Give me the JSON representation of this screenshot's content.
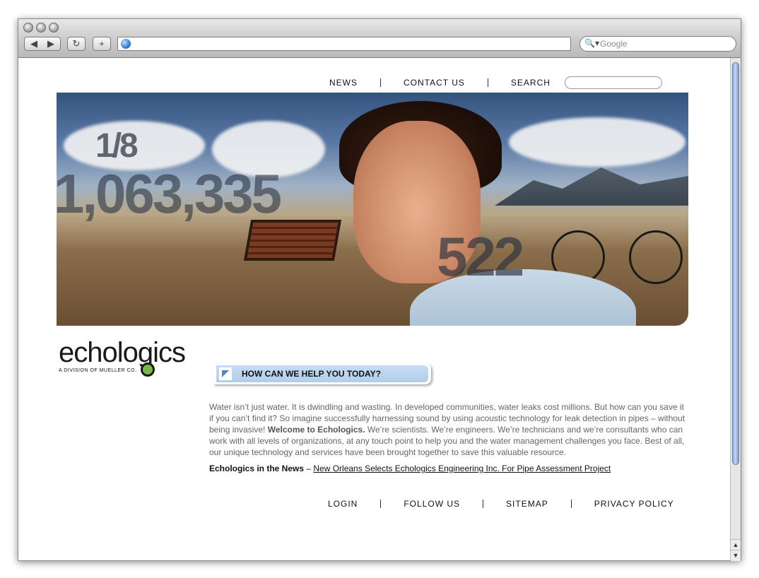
{
  "browser": {
    "url": "",
    "search_engine": "Google",
    "back_glyph": "◀",
    "forward_glyph": "▶",
    "reload_glyph": "↻",
    "add_glyph": "+",
    "search_glass_glyph": "🔍▾",
    "scroll_up_glyph": "▲",
    "scroll_down_glyph": "▼"
  },
  "top_nav": {
    "news": "NEWS",
    "contact": "CONTACT US",
    "search": "SEARCH",
    "search_value": ""
  },
  "hero": {
    "stat_fraction": "1/8",
    "stat_big": "1,063,335",
    "stat_522": "522"
  },
  "logo": {
    "name": "echologics",
    "tagline": "A DIVISION OF MUELLER CO."
  },
  "help_banner": "HOW CAN WE HELP YOU TODAY?",
  "intro": {
    "part1": "Water isn’t just water. It is dwindling and wasting. In developed communities, water leaks cost millions. But how can you save it if you can’t find it? So imagine successfully harnessing sound by using acoustic technology for leak detection in pipes – without being invasive! ",
    "bold": "Welcome to Echologics.",
    "part2": " We’re scientists. We’re engineers. We’re technicians and we’re consultants who can work with all levels of organizations, at any touch point to help you and the water management challenges you face. Best of all, our unique technology and services have been brought together to save this valuable resource."
  },
  "news": {
    "label": "Echologics in the News",
    "dash": " – ",
    "link": "New Orleans Selects Echologics Engineering Inc. For Pipe Assessment Project"
  },
  "footer_nav": {
    "login": "LOGIN",
    "follow": "FOLLOW US",
    "sitemap": "SITEMAP",
    "privacy": "PRIVACY POLICY"
  }
}
